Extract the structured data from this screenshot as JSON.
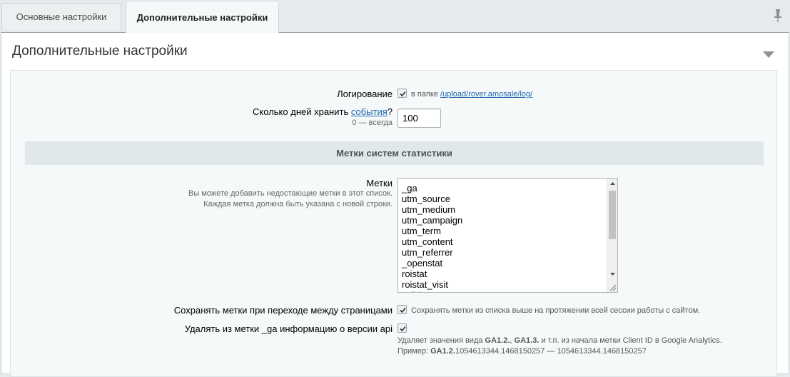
{
  "tabs": [
    {
      "label": "Основные настройки",
      "active": false
    },
    {
      "label": "Дополнительные настройки",
      "active": true
    }
  ],
  "panel": {
    "title": "Дополнительные настройки"
  },
  "logging": {
    "label": "Логирование",
    "checked": true,
    "note_prefix": "в папке",
    "note_link": "/upload/rover.amosale/log/"
  },
  "days": {
    "label_prefix": "Сколько дней хранить ",
    "label_link": "события",
    "label_suffix": "?",
    "hint": "0 — всегда",
    "value": "100"
  },
  "section": {
    "title": "Метки систем статистики"
  },
  "tags": {
    "label": "Метки",
    "hint1": "Вы можете добавить недостающие метки в этот список.",
    "hint2": "Каждая метка должна быть указана с новой строки.",
    "lines": [
      "_ga",
      "utm_source",
      "utm_medium",
      "utm_campaign",
      "utm_term",
      "utm_content",
      "utm_referrer",
      "_openstat",
      "roistat",
      "roistat_visit",
      "yclid"
    ]
  },
  "save_tags": {
    "label": "Сохранять метки при переходе между страницами",
    "checked": true,
    "note": "Сохранять метки из списка выше на протяжении всей сессии работы с сайтом."
  },
  "remove_ga": {
    "label": "Удалять из метки _ga информацию о версии api",
    "checked": true,
    "note1_a": "Удаляет значения вида ",
    "note1_b": "GA1.2.",
    "note1_c": ", ",
    "note1_d": "GA1.3.",
    "note1_e": " и т.п. из начала метки Client ID в Google Analytics.",
    "note2_a": "Пример: ",
    "note2_b": "GA1.2.",
    "note2_c": "1054613344.1468150257 — 1054613344.1468150257"
  },
  "colors": {
    "link": "#2067b0",
    "section_bg": "#e0e8ea",
    "panel_bg": "#f5f9f9"
  }
}
